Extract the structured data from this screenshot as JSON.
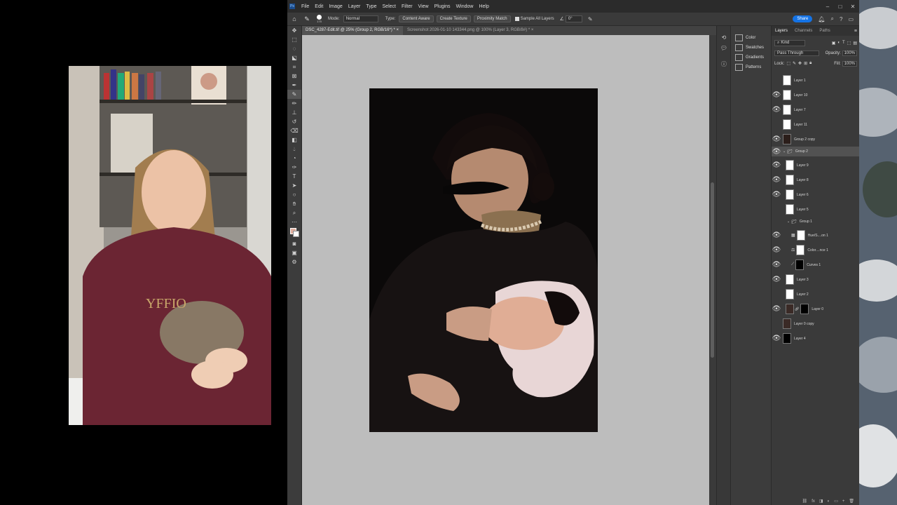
{
  "menu": [
    "File",
    "Edit",
    "Image",
    "Layer",
    "Type",
    "Select",
    "Filter",
    "View",
    "Plugins",
    "Window",
    "Help"
  ],
  "options_bar": {
    "brush_size": "175",
    "mode_label": "Mode:",
    "mode_value": "Normal",
    "type_label": "Type:",
    "content_aware": "Content Aware",
    "create_texture": "Create Texture",
    "proximity_match": "Proximity Match",
    "sample_all_layers": "Sample All Layers",
    "angle": "0°",
    "share": "Share"
  },
  "doc_tabs": [
    {
      "label": "DSC_4287-Edit.tif @ 25% (Group 2, RGB/16*) *",
      "active": true
    },
    {
      "label": "Screenshot 2026-01-10 143344.png @ 100% (Layer 3, RGB/8#) *",
      "active": false
    }
  ],
  "mini_panel": [
    "Color",
    "Swatches",
    "Gradients",
    "Patterns"
  ],
  "layers_panel": {
    "tabs": [
      "Layers",
      "Channels",
      "Paths"
    ],
    "kind": "Kind",
    "blend_mode": "Pass Through",
    "opacity_label": "Opacity:",
    "opacity": "100%",
    "lock_label": "Lock:",
    "fill_label": "Fill:",
    "fill": "100%",
    "rows": [
      {
        "name": "Layer 1",
        "visible": false
      },
      {
        "name": "Layer 10",
        "visible": true
      },
      {
        "name": "Layer 7",
        "visible": true
      },
      {
        "name": "Layer 11",
        "visible": false
      },
      {
        "name": "Group 2 copy",
        "visible": true
      },
      {
        "name": "Group 2",
        "visible": true
      },
      {
        "name": "Layer 9",
        "visible": true
      },
      {
        "name": "Layer 8",
        "visible": true
      },
      {
        "name": "Layer 6",
        "visible": true
      },
      {
        "name": "Layer 5",
        "visible": true
      },
      {
        "name": "Group 1",
        "visible": false
      },
      {
        "name": "Hue/S....on 1",
        "visible": true
      },
      {
        "name": "Color....nce 1",
        "visible": true
      },
      {
        "name": "Curves 1",
        "visible": true
      },
      {
        "name": "Layer 3",
        "visible": true
      },
      {
        "name": "Layer 2",
        "visible": false
      },
      {
        "name": "Layer 0",
        "visible": true
      },
      {
        "name": "Layer 0 copy",
        "visible": false
      },
      {
        "name": "Layer 4",
        "visible": true
      }
    ]
  }
}
